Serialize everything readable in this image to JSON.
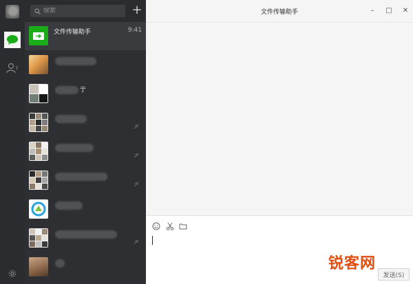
{
  "search": {
    "placeholder": "搜索"
  },
  "add_button": {
    "label": "+"
  },
  "conversations": [
    {
      "name": "文件传输助手",
      "time": "9:41",
      "active": true
    },
    {
      "name": "",
      "time": ""
    },
    {
      "name": "亍",
      "time": ""
    },
    {
      "name": "",
      "time": ""
    },
    {
      "name": "",
      "time": ""
    },
    {
      "name": "",
      "time": ""
    },
    {
      "name": "",
      "time": ""
    },
    {
      "name": "",
      "time": ""
    },
    {
      "name": "",
      "time": ""
    }
  ],
  "chat": {
    "title": "文件传输助手",
    "window_controls": {
      "minimize": "–",
      "maximize": "□",
      "close": "✕"
    }
  },
  "composer": {
    "send_label": "发送(S)",
    "value": ""
  },
  "watermark": {
    "text": "锐客网"
  },
  "colors": {
    "accent": "#1aad19",
    "rail": "#2b2c2f",
    "list": "#2e2f33",
    "active_row": "#3a3b3f",
    "watermark": "#e24d10"
  },
  "icons": {
    "chat": "chat-bubble-icon",
    "contacts": "contacts-icon",
    "settings": "gear-icon",
    "emoji": "emoji-icon",
    "screenshot": "scissors-icon",
    "file": "folder-icon",
    "search": "search-icon"
  }
}
